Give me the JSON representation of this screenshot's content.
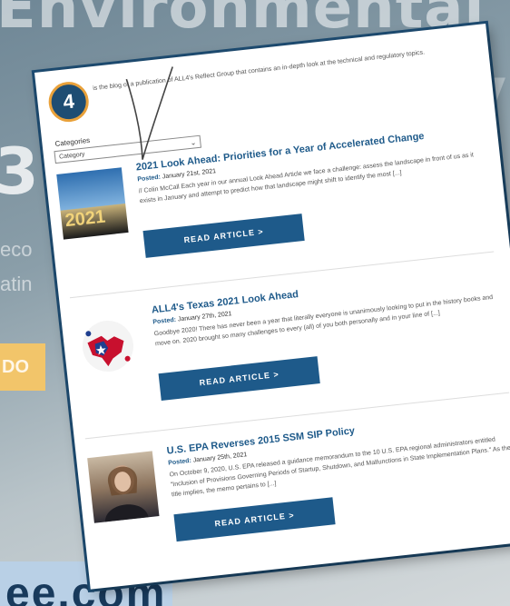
{
  "background": {
    "title": "Environmental",
    "letter_right": "y",
    "digit_left": "3",
    "line1": "eco",
    "line2": "atin",
    "button_label": "DO",
    "url": "ee.com"
  },
  "newsletter": {
    "intro": "is the blog of a publication of ALL4's Reflect Group that contains an in-depth look at the technical and regulatory topics.",
    "logo_text": "4",
    "categories_label": "Categories",
    "category_value": "Category",
    "articles": [
      {
        "title": "2021 Look Ahead: Priorities for a Year of Accelerated Change",
        "posted_label": "Posted:",
        "posted_date": "January 21st, 2021",
        "excerpt": "// Colin McCall Each year in our annual Look Ahead Article we face a challenge: assess the landscape in front of us as it exists in January and attempt to predict how that landscape might shift to identify the most [...]",
        "button": "READ ARTICLE  >",
        "thumb_text": "2021"
      },
      {
        "title": "ALL4's Texas 2021 Look Ahead",
        "posted_label": "Posted:",
        "posted_date": "January 27th, 2021",
        "excerpt": "Goodbye 2020! There has never been a year that literally everyone is unanimously looking to put in the history books and move on. 2020 brought so many challenges to every (all) of you both personally and in your line of [...]",
        "button": "READ ARTICLE  >"
      },
      {
        "title": "U.S. EPA Reverses 2015 SSM SIP Policy",
        "posted_label": "Posted:",
        "posted_date": "January 25th, 2021",
        "excerpt": "On October 9, 2020, U.S. EPA released a guidance memorandum to the 10 U.S. EPA regional administrators entitled \"Inclusion of Provisions Governing Periods of Startup, Shutdown, and Malfunctions in State Implementation Plans.\" As the title implies, the memo pertains to [...]",
        "button": "READ ARTICLE  >"
      }
    ]
  }
}
